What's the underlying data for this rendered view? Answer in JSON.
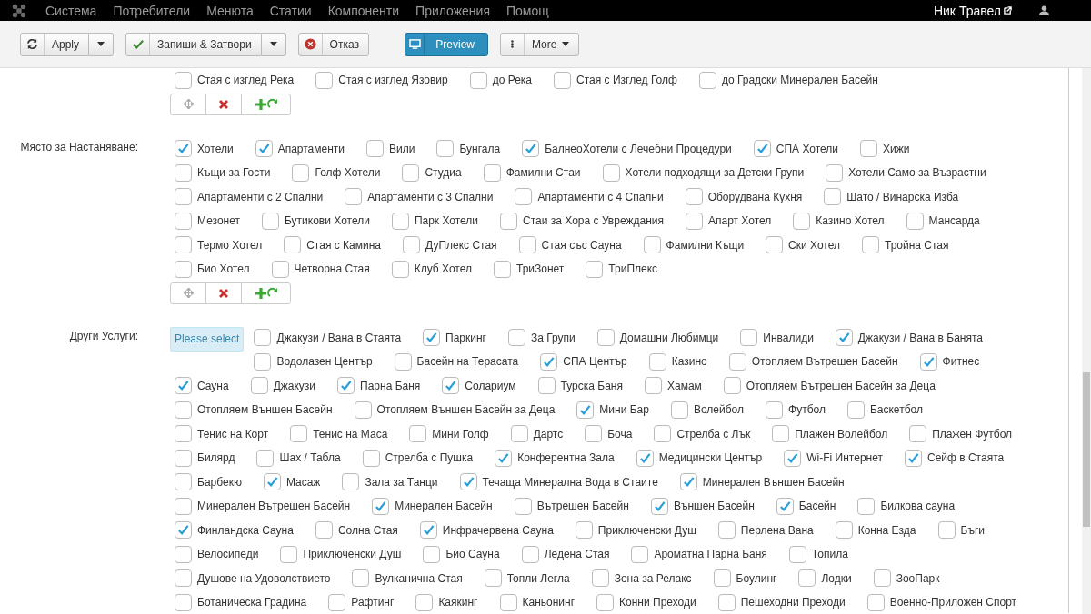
{
  "navbar": {
    "menu": [
      "Система",
      "Потребители",
      "Менюта",
      "Статии",
      "Компоненти",
      "Приложения",
      "Помощ"
    ],
    "user": "Ник Травел"
  },
  "toolbar": {
    "apply": "Apply",
    "save_close": "Запиши & Затвори",
    "cancel": "Отказ",
    "preview": "Preview",
    "more": "More"
  },
  "sections": [
    {
      "row_controls": true,
      "options": [
        {
          "label": "Стая с изглед Река",
          "checked": false
        },
        {
          "label": "Стая с изглед Язовир",
          "checked": false
        },
        {
          "label": "до Река",
          "checked": false
        },
        {
          "label": "Стая с Изглед Голф",
          "checked": false
        },
        {
          "label": "до Градски Минерален Басейн",
          "checked": false
        }
      ]
    },
    {
      "label": "Място за Настаняване:",
      "row_controls": true,
      "options": [
        {
          "label": "Хотели",
          "checked": true
        },
        {
          "label": "Апартаменти",
          "checked": true
        },
        {
          "label": "Вили",
          "checked": false
        },
        {
          "label": "Бунгала",
          "checked": false
        },
        {
          "label": "БалнеоХотели с Лечебни Процедури",
          "checked": true
        },
        {
          "label": "СПА Хотели",
          "checked": true
        },
        {
          "label": "Хижи",
          "checked": false
        },
        {
          "label": "Къщи за Гости",
          "checked": false
        },
        {
          "label": "Голф Хотели",
          "checked": false
        },
        {
          "label": "Студиа",
          "checked": false
        },
        {
          "label": "Фамилни Стаи",
          "checked": false
        },
        {
          "label": "Хотели подходящи за Детски Групи",
          "checked": false
        },
        {
          "label": "Хотели Само за Възрастни",
          "checked": false
        },
        {
          "label": "Апартаменти с 2 Спални",
          "checked": false
        },
        {
          "label": "Апартаменти с 3 Спални",
          "checked": false
        },
        {
          "label": "Апартаменти с 4 Спални",
          "checked": false
        },
        {
          "label": "Оборудвана Кухня",
          "checked": false
        },
        {
          "label": "Шато / Винарска Изба",
          "checked": false
        },
        {
          "label": "Мезонет",
          "checked": false
        },
        {
          "label": "Бутикови Хотели",
          "checked": false
        },
        {
          "label": "Парк Хотели",
          "checked": false
        },
        {
          "label": "Стаи за Хора с Увреждания",
          "checked": false
        },
        {
          "label": "Апарт Хотел",
          "checked": false
        },
        {
          "label": "Казино Хотел",
          "checked": false
        },
        {
          "label": "Мансарда",
          "checked": false
        },
        {
          "label": "Термо Хотел",
          "checked": false
        },
        {
          "label": "Стая с Камина",
          "checked": false
        },
        {
          "label": "ДуПлекс Стая",
          "checked": false
        },
        {
          "label": "Стая със Сауна",
          "checked": false
        },
        {
          "label": "Фамилни Къщи",
          "checked": false
        },
        {
          "label": "Ски Хотел",
          "checked": false
        },
        {
          "label": "Тройна Стая",
          "checked": false
        },
        {
          "label": "Био Хотел",
          "checked": false
        },
        {
          "label": "Четворна Стая",
          "checked": false
        },
        {
          "label": "Клуб Хотел",
          "checked": false
        },
        {
          "label": "ТриЗонет",
          "checked": false
        },
        {
          "label": "ТриПлекс",
          "checked": false
        }
      ]
    },
    {
      "label": "Други Услуги:",
      "select_button": "Please select",
      "row_controls": false,
      "options": [
        {
          "label": "Джакузи / Вана в Стаята",
          "checked": false
        },
        {
          "label": "Паркинг",
          "checked": true
        },
        {
          "label": "За Групи",
          "checked": false
        },
        {
          "label": "Домашни Любимци",
          "checked": false
        },
        {
          "label": "Инвалиди",
          "checked": false
        },
        {
          "label": "Джакузи / Вана в Банята",
          "checked": true
        },
        {
          "label": "Водолазен Център",
          "checked": false
        },
        {
          "label": "Басейн на Терасата",
          "checked": false
        },
        {
          "label": "СПА Център",
          "checked": true
        },
        {
          "label": "Казино",
          "checked": false
        },
        {
          "label": "Отопляем Вътрешен Басейн",
          "checked": false
        },
        {
          "label": "Фитнес",
          "checked": true
        },
        {
          "label": "Сауна",
          "checked": true
        },
        {
          "label": "Джакузи",
          "checked": false
        },
        {
          "label": "Парна Баня",
          "checked": true
        },
        {
          "label": "Солариум",
          "checked": true
        },
        {
          "label": "Турска Баня",
          "checked": false
        },
        {
          "label": "Хамам",
          "checked": false
        },
        {
          "label": "Отопляем Вътрешен Басейн за Деца",
          "checked": false
        },
        {
          "label": "Отопляем Външен Басейн",
          "checked": false
        },
        {
          "label": "Отопляем Външен Басейн за Деца",
          "checked": false
        },
        {
          "label": "Мини Бар",
          "checked": true
        },
        {
          "label": "Волейбол",
          "checked": false
        },
        {
          "label": "Футбол",
          "checked": false
        },
        {
          "label": "Баскетбол",
          "checked": false
        },
        {
          "label": "Тенис на Корт",
          "checked": false
        },
        {
          "label": "Тенис на Маса",
          "checked": false
        },
        {
          "label": "Мини Голф",
          "checked": false
        },
        {
          "label": "Дартс",
          "checked": false
        },
        {
          "label": "Боча",
          "checked": false
        },
        {
          "label": "Стрелба с Лък",
          "checked": false
        },
        {
          "label": "Плажен Волейбол",
          "checked": false
        },
        {
          "label": "Плажен Футбол",
          "checked": false
        },
        {
          "label": "Билярд",
          "checked": false
        },
        {
          "label": "Шах / Табла",
          "checked": false
        },
        {
          "label": "Стрелба с Пушка",
          "checked": false
        },
        {
          "label": "Конферентна Зала",
          "checked": true
        },
        {
          "label": "Медицински Център",
          "checked": true
        },
        {
          "label": "Wi-Fi Интернет",
          "checked": true
        },
        {
          "label": "Сейф в Стаята",
          "checked": true
        },
        {
          "label": "Барбекю",
          "checked": false
        },
        {
          "label": "Масаж",
          "checked": true
        },
        {
          "label": "Зала за Танци",
          "checked": false
        },
        {
          "label": "Течаща Минерална Вода в Стаите",
          "checked": true
        },
        {
          "label": "Минерален Външен Басейн",
          "checked": true
        },
        {
          "label": "Минерален Вътрешен Басейн",
          "checked": false
        },
        {
          "label": "Минерален Басейн",
          "checked": true
        },
        {
          "label": "Вътрешен Басейн",
          "checked": false
        },
        {
          "label": "Външен Басейн",
          "checked": true
        },
        {
          "label": "Басейн",
          "checked": true
        },
        {
          "label": "Билкова сауна",
          "checked": false
        },
        {
          "label": "Финландска Сауна",
          "checked": true
        },
        {
          "label": "Солна Стая",
          "checked": false
        },
        {
          "label": "Инфрачервена Сауна",
          "checked": true
        },
        {
          "label": "Приключенски Душ",
          "checked": false
        },
        {
          "label": "Перлена Вана",
          "checked": false
        },
        {
          "label": "Конна Езда",
          "checked": false
        },
        {
          "label": "Бъги",
          "checked": false
        },
        {
          "label": "Велосипеди",
          "checked": false
        },
        {
          "label": "Приключенски Душ",
          "checked": false
        },
        {
          "label": "Био Сауна",
          "checked": false
        },
        {
          "label": "Ледена Стая",
          "checked": false
        },
        {
          "label": "Ароматна Парна Баня",
          "checked": false
        },
        {
          "label": "Топила",
          "checked": false
        },
        {
          "label": "Душове на Удоволствието",
          "checked": false
        },
        {
          "label": "Вулканична Стая",
          "checked": false
        },
        {
          "label": "Топли Легла",
          "checked": false
        },
        {
          "label": "Зона за Релакс",
          "checked": false
        },
        {
          "label": "Боулинг",
          "checked": false
        },
        {
          "label": "Лодки",
          "checked": false
        },
        {
          "label": "ЗооПарк",
          "checked": false
        },
        {
          "label": "Ботаническа Градина",
          "checked": false
        },
        {
          "label": "Рафтинг",
          "checked": false
        },
        {
          "label": "Каякинг",
          "checked": false
        },
        {
          "label": "Каньонинг",
          "checked": false
        },
        {
          "label": "Конни Преходи",
          "checked": false
        },
        {
          "label": "Пешеходни Преходи",
          "checked": false
        },
        {
          "label": "Военно-Приложен Спорт",
          "checked": false
        }
      ]
    }
  ]
}
